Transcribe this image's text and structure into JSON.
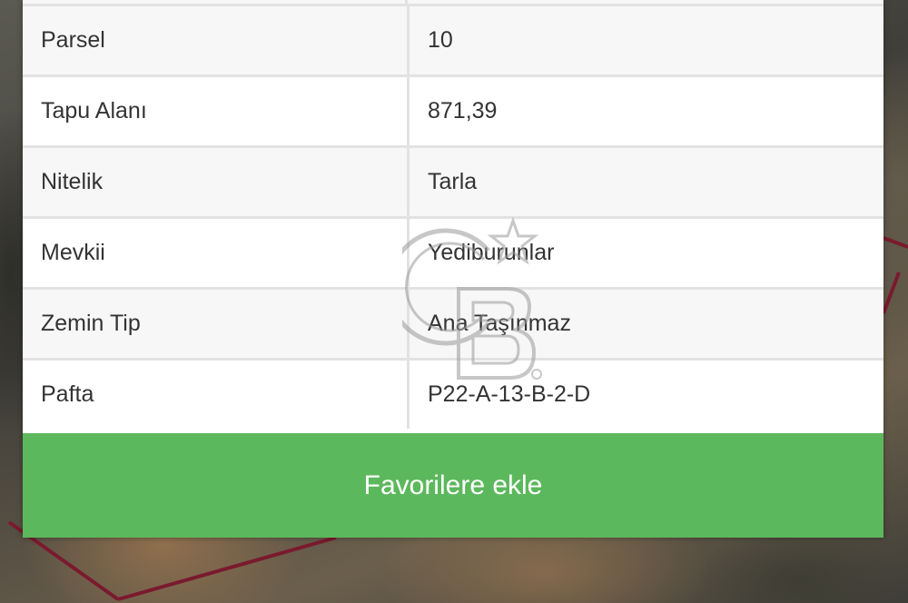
{
  "rows": [
    {
      "label": "Parsel",
      "value": "10"
    },
    {
      "label": "Tapu Alanı",
      "value": "871,39"
    },
    {
      "label": "Nitelik",
      "value": "Tarla"
    },
    {
      "label": "Mevkii",
      "value": "Yediburunlar"
    },
    {
      "label": "Zemin Tip",
      "value": "Ana Taşınmaz"
    },
    {
      "label": "Pafta",
      "value": "P22-A-13-B-2-D"
    }
  ],
  "favorite_button": {
    "label": "Favorilere ekle"
  },
  "colors": {
    "button_green": "#5cb85c",
    "row_alt": "#f7f7f7",
    "border": "#e2e2e2",
    "parcel_outline": "#7a1a2e"
  },
  "icons": {
    "watermark": "cb-logo-watermark"
  }
}
